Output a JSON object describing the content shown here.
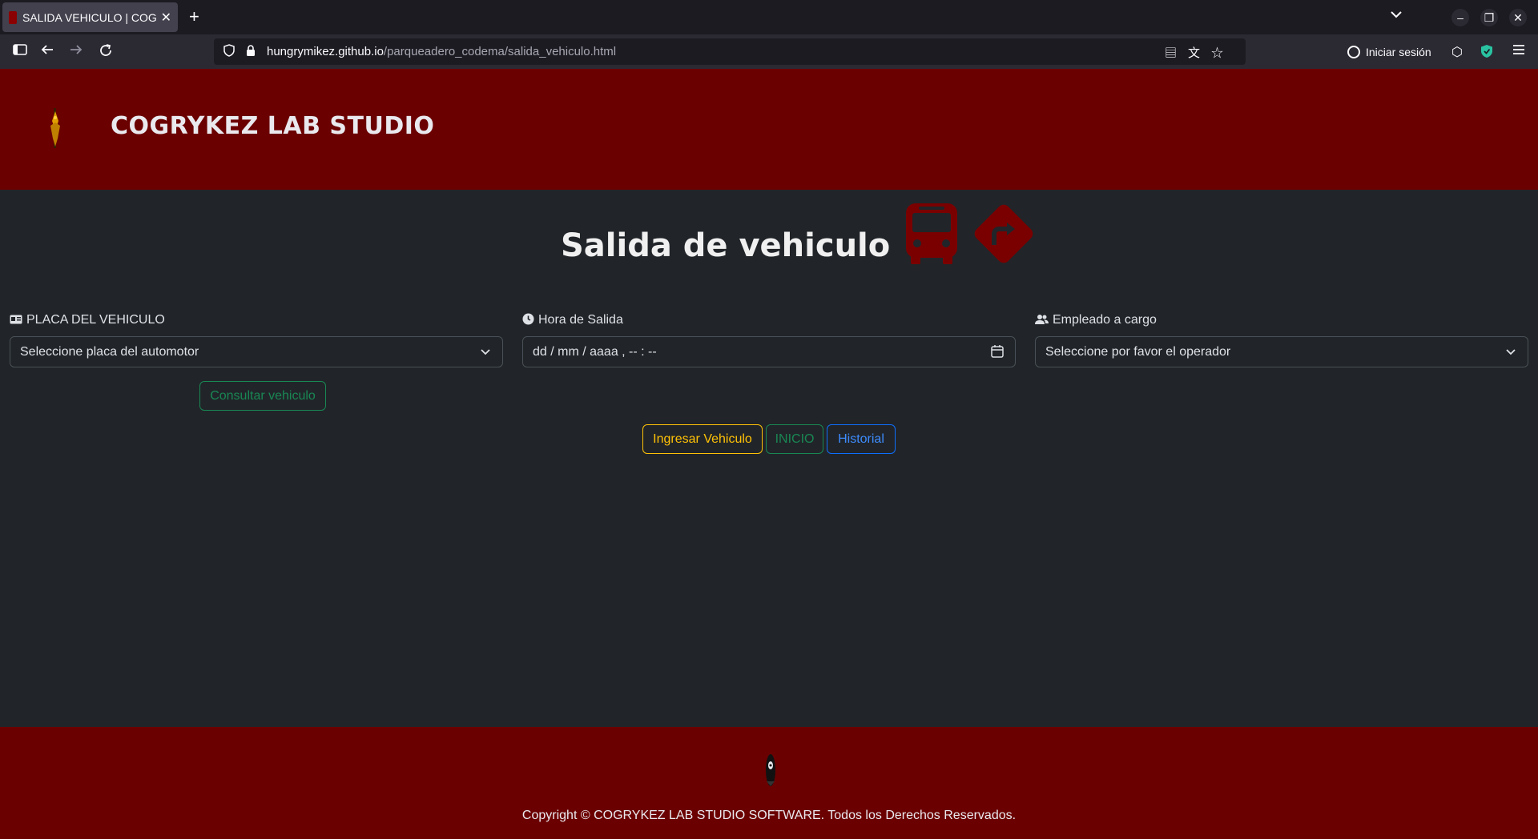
{
  "browser": {
    "tab_title": "SALIDA VEHICULO | COGRYKEZ",
    "tab_close": "✕",
    "new_tab": "+",
    "url_host": "hungrymikez.github.io",
    "url_path": "/parqueadero_codema/salida_vehiculo.html",
    "sign_in": "Iniciar sesión"
  },
  "header": {
    "title": "COGRYKEZ LAB STUDIO"
  },
  "main": {
    "heading": "Salida de vehiculo",
    "icons": [
      "bus-icon",
      "sign-turn-right-icon"
    ],
    "fields": {
      "placa": {
        "label": "PLACA DEL VEHICULO",
        "icon": "vehicle-card-icon",
        "value": "Seleccione placa del automotor"
      },
      "hora": {
        "label": "Hora de Salida",
        "icon": "clock-icon",
        "placeholder": "dd / mm / aaaa ,  -- : --"
      },
      "empleado": {
        "label": "Empleado a cargo",
        "icon": "users-icon",
        "value": "Seleccione por favor el operador"
      }
    },
    "buttons": {
      "consultar": "Consultar vehiculo",
      "ingresar": "Ingresar Vehiculo",
      "inicio": "INICIO",
      "historial": "Historial"
    }
  },
  "footer": {
    "copyright": "Copyright © COGRYKEZ LAB STUDIO SOFTWARE. Todos los Derechos Reservados."
  },
  "colors": {
    "brand": "#6b0000",
    "background": "#212529",
    "success": "#198754",
    "warning": "#ffc107",
    "primary": "#0d6efd",
    "icon_accent": "#7a0000"
  }
}
